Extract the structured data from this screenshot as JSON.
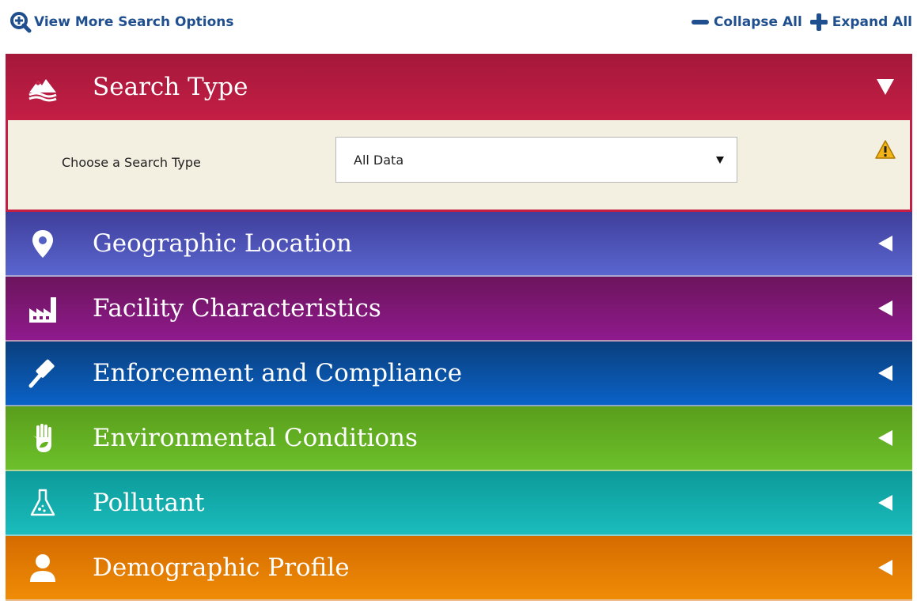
{
  "toolbar": {
    "view_more_label": "View More Search Options",
    "collapse_all_label": "Collapse All",
    "expand_all_label": "Expand All"
  },
  "panels": [
    {
      "title": "Search Type",
      "icon": "mountains-icon",
      "color": "#c41e45",
      "expanded": true
    },
    {
      "title": "Geographic Location",
      "icon": "map-pin-icon",
      "color": "#5a66cf",
      "expanded": false
    },
    {
      "title": "Facility Characteristics",
      "icon": "factory-icon",
      "color": "#8f1a8d",
      "expanded": false
    },
    {
      "title": "Enforcement and Compliance",
      "icon": "gavel-icon",
      "color": "#0a62c7",
      "expanded": false
    },
    {
      "title": "Environmental Conditions",
      "icon": "hand-leaf-icon",
      "color": "#6cc02a",
      "expanded": false
    },
    {
      "title": "Pollutant",
      "icon": "flask-icon",
      "color": "#1bbcbd",
      "expanded": false
    },
    {
      "title": "Demographic Profile",
      "icon": "person-icon",
      "color": "#ef8c06",
      "expanded": false
    }
  ],
  "search_type": {
    "label": "Choose a Search Type",
    "selected_value": "All Data"
  }
}
